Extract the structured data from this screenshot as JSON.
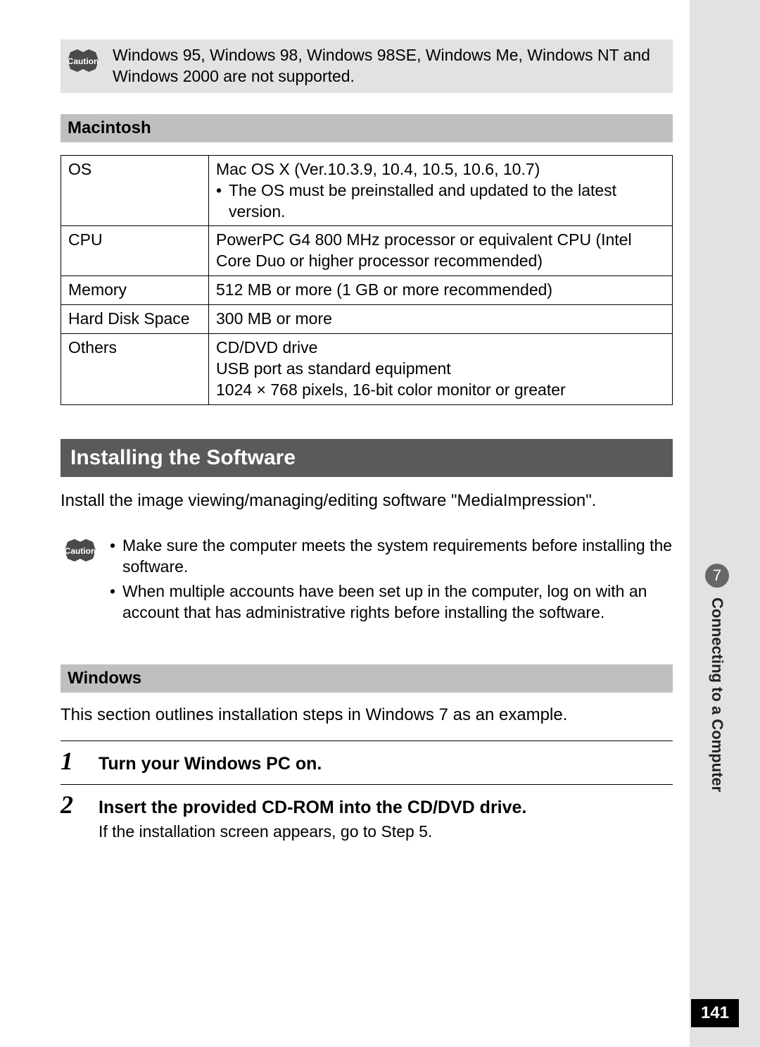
{
  "caution_label": "Caution",
  "caution1_text": "Windows 95, Windows 98, Windows 98SE, Windows Me, Windows NT and Windows 2000 are not supported.",
  "mac_heading": "Macintosh",
  "spec_rows": [
    {
      "k": "OS",
      "v_line1": "Mac OS X (Ver.10.3.9, 10.4, 10.5, 10.6, 10.7)",
      "v_bullet": "The OS must be preinstalled and updated to the latest version."
    },
    {
      "k": "CPU",
      "v": "PowerPC G4 800 MHz processor or equivalent CPU (Intel Core Duo or higher processor recommended)"
    },
    {
      "k": "Memory",
      "v": "512 MB or more (1 GB or more recommended)"
    },
    {
      "k": "Hard Disk Space",
      "v": "300 MB or more"
    },
    {
      "k": "Others",
      "v_lines": [
        "CD/DVD drive",
        "USB port as standard equipment",
        "1024 × 768 pixels, 16-bit color monitor or greater"
      ]
    }
  ],
  "install_heading": "Installing the Software",
  "install_intro": "Install the image viewing/managing/editing software \"MediaImpression\".",
  "caution2_items": [
    "Make sure the computer meets the system requirements before installing the software.",
    "When multiple accounts have been set up in the computer, log on with an account that has administrative rights before installing the software."
  ],
  "win_heading": "Windows",
  "win_intro": "This section outlines installation steps in Windows 7 as an example.",
  "steps": [
    {
      "n": "1",
      "title": "Turn your Windows PC on."
    },
    {
      "n": "2",
      "title": "Insert the provided CD-ROM into the CD/DVD drive.",
      "sub": "If the installation screen appears, go to Step 5."
    }
  ],
  "tab_number": "7",
  "tab_label": "Connecting to a Computer",
  "page_number": "141"
}
